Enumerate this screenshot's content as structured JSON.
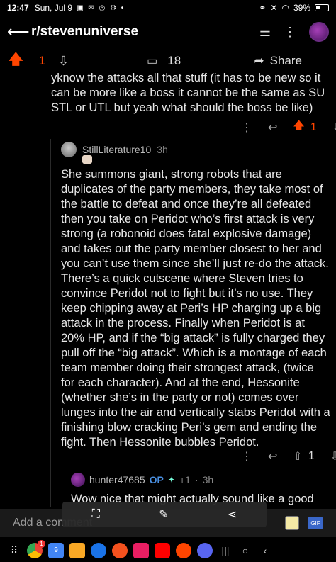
{
  "status_bar": {
    "time": "12:47",
    "date": "Sun, Jul 9",
    "battery": "39%"
  },
  "header": {
    "title": "r/stevenuniverse"
  },
  "post_actions": {
    "votes": "1",
    "comments": "18",
    "share_label": "Share"
  },
  "parent_comment": {
    "text": "yknow the attacks all that stuff (it has to be new so it can be more like a boss it cannot be the same as SU STL or UTL but yeah what should the boss be like)",
    "votes": "1"
  },
  "reply": {
    "username": "StillLiterature10",
    "time": "3h",
    "body": "She summons giant, strong robots that are duplicates of the party members, they take most of the battle to defeat and once they’re all defeated then you take on Peridot who’s first attack is very strong (a robonoid does fatal explosive damage) and takes out the party member closest to her and you can’t use them since she’ll just re-do the attack. There’s a quick cutscene where Steven tries to convince Peridot not to fight but it’s no use. They keep chipping away at Peri’s HP charging up a big attack in the process. Finally when Peridot is at 20% HP, and if the “big attack” is fully charged they pull off the “big attack”. Which is a montage of each team member doing their strongest attack, (twice for each character). And at the end, Hessonite (whether she’s in the party or not) comes over lunges into the air and vertically stabs Peridot with a finishing blow cracking Peri’s gem and ending the fight. Then Hessonite bubbles Peridot.",
    "votes": "1"
  },
  "reply2": {
    "username": "hunter47685",
    "op_label": "OP",
    "award": "+1",
    "time": "3h",
    "body": "Wow nice that might actually sound like a good"
  },
  "comment_input": {
    "placeholder": "Add a comment"
  },
  "dock": {
    "chrome_badge": "1",
    "calendar_day": "9"
  }
}
